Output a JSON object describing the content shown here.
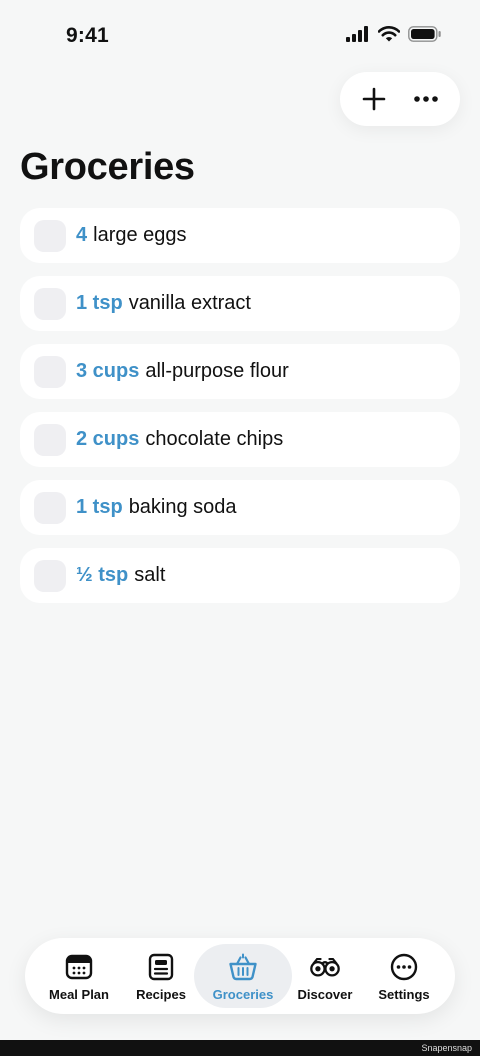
{
  "status": {
    "time": "9:41"
  },
  "title": "Groceries",
  "items": [
    {
      "qty": "4",
      "name": "large eggs"
    },
    {
      "qty": "1 tsp",
      "name": "vanilla extract"
    },
    {
      "qty": "3 cups",
      "name": "all-purpose flour"
    },
    {
      "qty": "2 cups",
      "name": "chocolate chips"
    },
    {
      "qty": "1 tsp",
      "name": "baking soda"
    },
    {
      "qty": "½ tsp",
      "name": "salt"
    }
  ],
  "tabs": [
    {
      "label": "Meal Plan",
      "icon": "calendar-icon"
    },
    {
      "label": "Recipes",
      "icon": "recipe-card-icon"
    },
    {
      "label": "Groceries",
      "icon": "basket-icon",
      "active": true
    },
    {
      "label": "Discover",
      "icon": "binoculars-icon"
    },
    {
      "label": "Settings",
      "icon": "more-circle-icon"
    }
  ],
  "colors": {
    "accent": "#3f91c8",
    "background": "#f6f7f7",
    "card": "#ffffff"
  },
  "footer": {
    "watermark": "Snapensnap"
  }
}
